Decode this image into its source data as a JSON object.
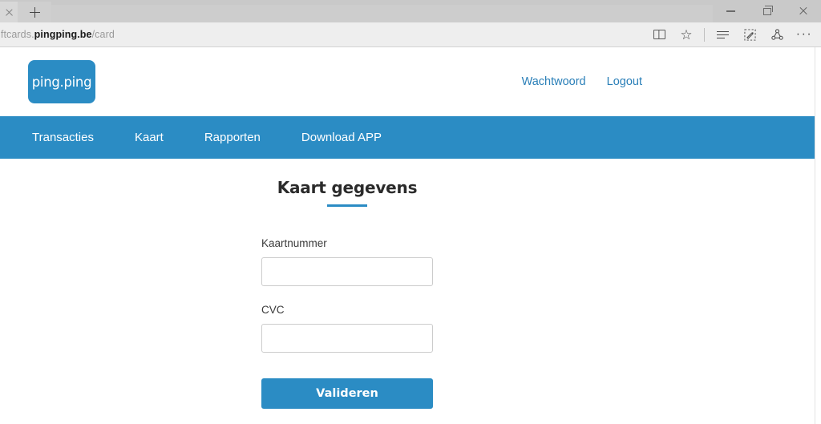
{
  "browser": {
    "name": "microsoft-edge",
    "tab_close_label": "×",
    "new_tab_label": "+",
    "address": {
      "prefix": "iftcards.",
      "host": "pingping.be",
      "path": "/card",
      "full": "iftcards.pingping.be/card"
    },
    "toolbar_icons": [
      {
        "name": "reading-view-icon",
        "glyph": "book"
      },
      {
        "name": "favorites-star-icon",
        "glyph": "☆"
      },
      {
        "name": "hub-icon",
        "glyph": "lines"
      },
      {
        "name": "web-note-icon",
        "glyph": "pencil"
      },
      {
        "name": "share-icon",
        "glyph": "share"
      },
      {
        "name": "more-settings-icon",
        "glyph": "···"
      }
    ],
    "window_controls": {
      "minimize": "—",
      "restore": "❐",
      "close": "✕"
    }
  },
  "site": {
    "logo_text": "ping.ping",
    "header_links": [
      {
        "label": "Wachtwoord"
      },
      {
        "label": "Logout"
      }
    ],
    "nav_items": [
      {
        "label": "Transacties"
      },
      {
        "label": "Kaart"
      },
      {
        "label": "Rapporten"
      },
      {
        "label": "Download APP"
      }
    ]
  },
  "form": {
    "title": "Kaart gegevens",
    "fields": [
      {
        "label": "Kaartnummer",
        "value": "",
        "placeholder": ""
      },
      {
        "label": "CVC",
        "value": "",
        "placeholder": ""
      }
    ],
    "submit_label": "Valideren"
  },
  "colors": {
    "brand_blue": "#2b8cc4",
    "link_blue": "#2a7fb8",
    "input_border": "#cccccc",
    "title_text": "#2b2b2b"
  }
}
